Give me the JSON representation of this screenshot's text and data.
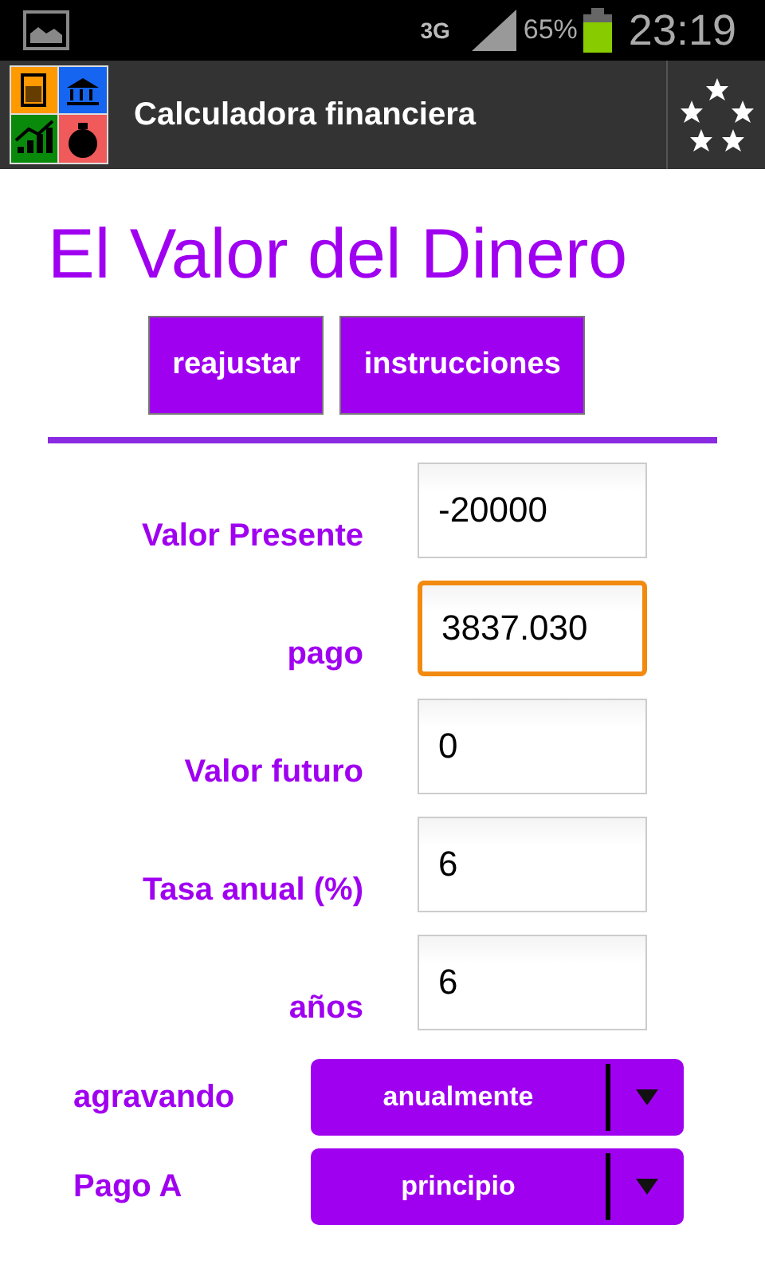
{
  "status_bar": {
    "network": "3G",
    "battery": "65%",
    "time": "23:19"
  },
  "app_bar": {
    "title": "Calculadora financiera"
  },
  "heading": "El Valor del Dinero",
  "buttons": [
    "reajustar",
    "instrucciones"
  ],
  "fields": [
    {
      "label": "Valor Presente",
      "value": "-20000",
      "focused": false
    },
    {
      "label": "pago",
      "value": "3837.030",
      "focused": true
    },
    {
      "label": "Valor futuro",
      "value": "0",
      "focused": false
    },
    {
      "label": "Tasa anual (%)",
      "value": "6",
      "focused": false
    },
    {
      "label": "años",
      "value": "6",
      "focused": false
    }
  ],
  "dropdowns": [
    {
      "label": "agravando",
      "value": "anualmente"
    },
    {
      "label": "Pago A",
      "value": "principio"
    }
  ]
}
